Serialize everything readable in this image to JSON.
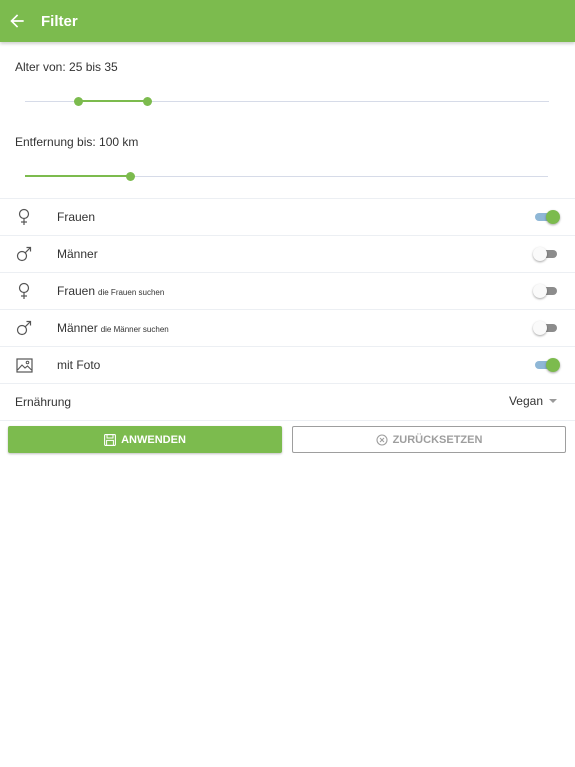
{
  "header": {
    "title": "Filter",
    "back_icon": "arrow-left-icon",
    "background_color": "#7cbb4e"
  },
  "age_filter": {
    "label": "Alter von: 25 bis 35",
    "min": 25,
    "max": 35
  },
  "distance_filter": {
    "label": "Entfernung bis: 100 km",
    "value": 100
  },
  "toggles": [
    {
      "icon": "female-icon",
      "label": "Frauen",
      "sublabel": "",
      "on": true
    },
    {
      "icon": "male-icon",
      "label": "Männer",
      "sublabel": "",
      "on": false
    },
    {
      "icon": "female-icon",
      "label": "Frauen",
      "sublabel": "die Frauen suchen",
      "on": false
    },
    {
      "icon": "male-icon",
      "label": "Männer",
      "sublabel": "die Männer suchen",
      "on": false
    },
    {
      "icon": "image-icon",
      "label": "mit Foto",
      "sublabel": "",
      "on": true
    }
  ],
  "diet": {
    "label": "Ernährung",
    "value": "Vegan"
  },
  "buttons": {
    "apply_label": "ANWENDEN",
    "apply_icon": "save-icon",
    "reset_label": "ZURÜCKSETZEN",
    "reset_icon": "cancel-circle-icon"
  },
  "colors": {
    "accent": "#7cbb4e",
    "toggle_track_on": "#8fb7d6",
    "toggle_track_off": "#8c8c8c"
  }
}
